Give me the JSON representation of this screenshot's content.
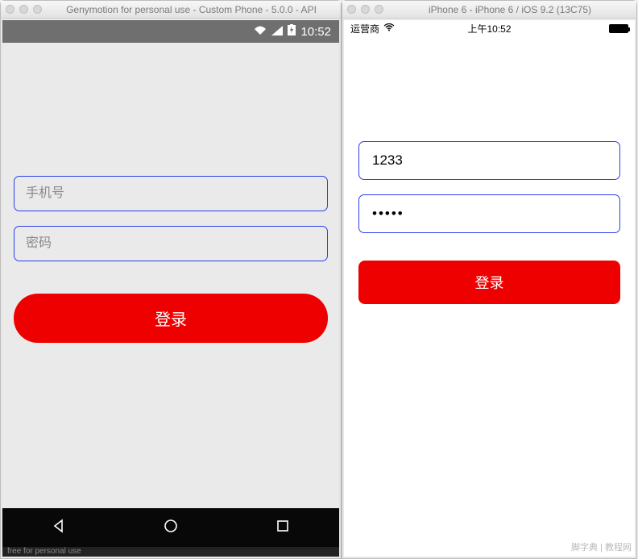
{
  "left_window": {
    "title": "Genymotion for personal use - Custom Phone - 5.0.0 - API",
    "statusbar": {
      "time": "10:52"
    },
    "form": {
      "phone_placeholder": "手机号",
      "password_placeholder": "密码",
      "login_label": "登录"
    },
    "bottom_text": "free for personal use"
  },
  "right_window": {
    "title": "iPhone 6 - iPhone 6 / iOS 9.2 (13C75)",
    "statusbar": {
      "carrier": "运营商",
      "time": "上午10:52"
    },
    "form": {
      "phone_value": "1233",
      "password_value": "•••••",
      "login_label": "登录"
    }
  },
  "watermark": "脚字典 | 教程网"
}
